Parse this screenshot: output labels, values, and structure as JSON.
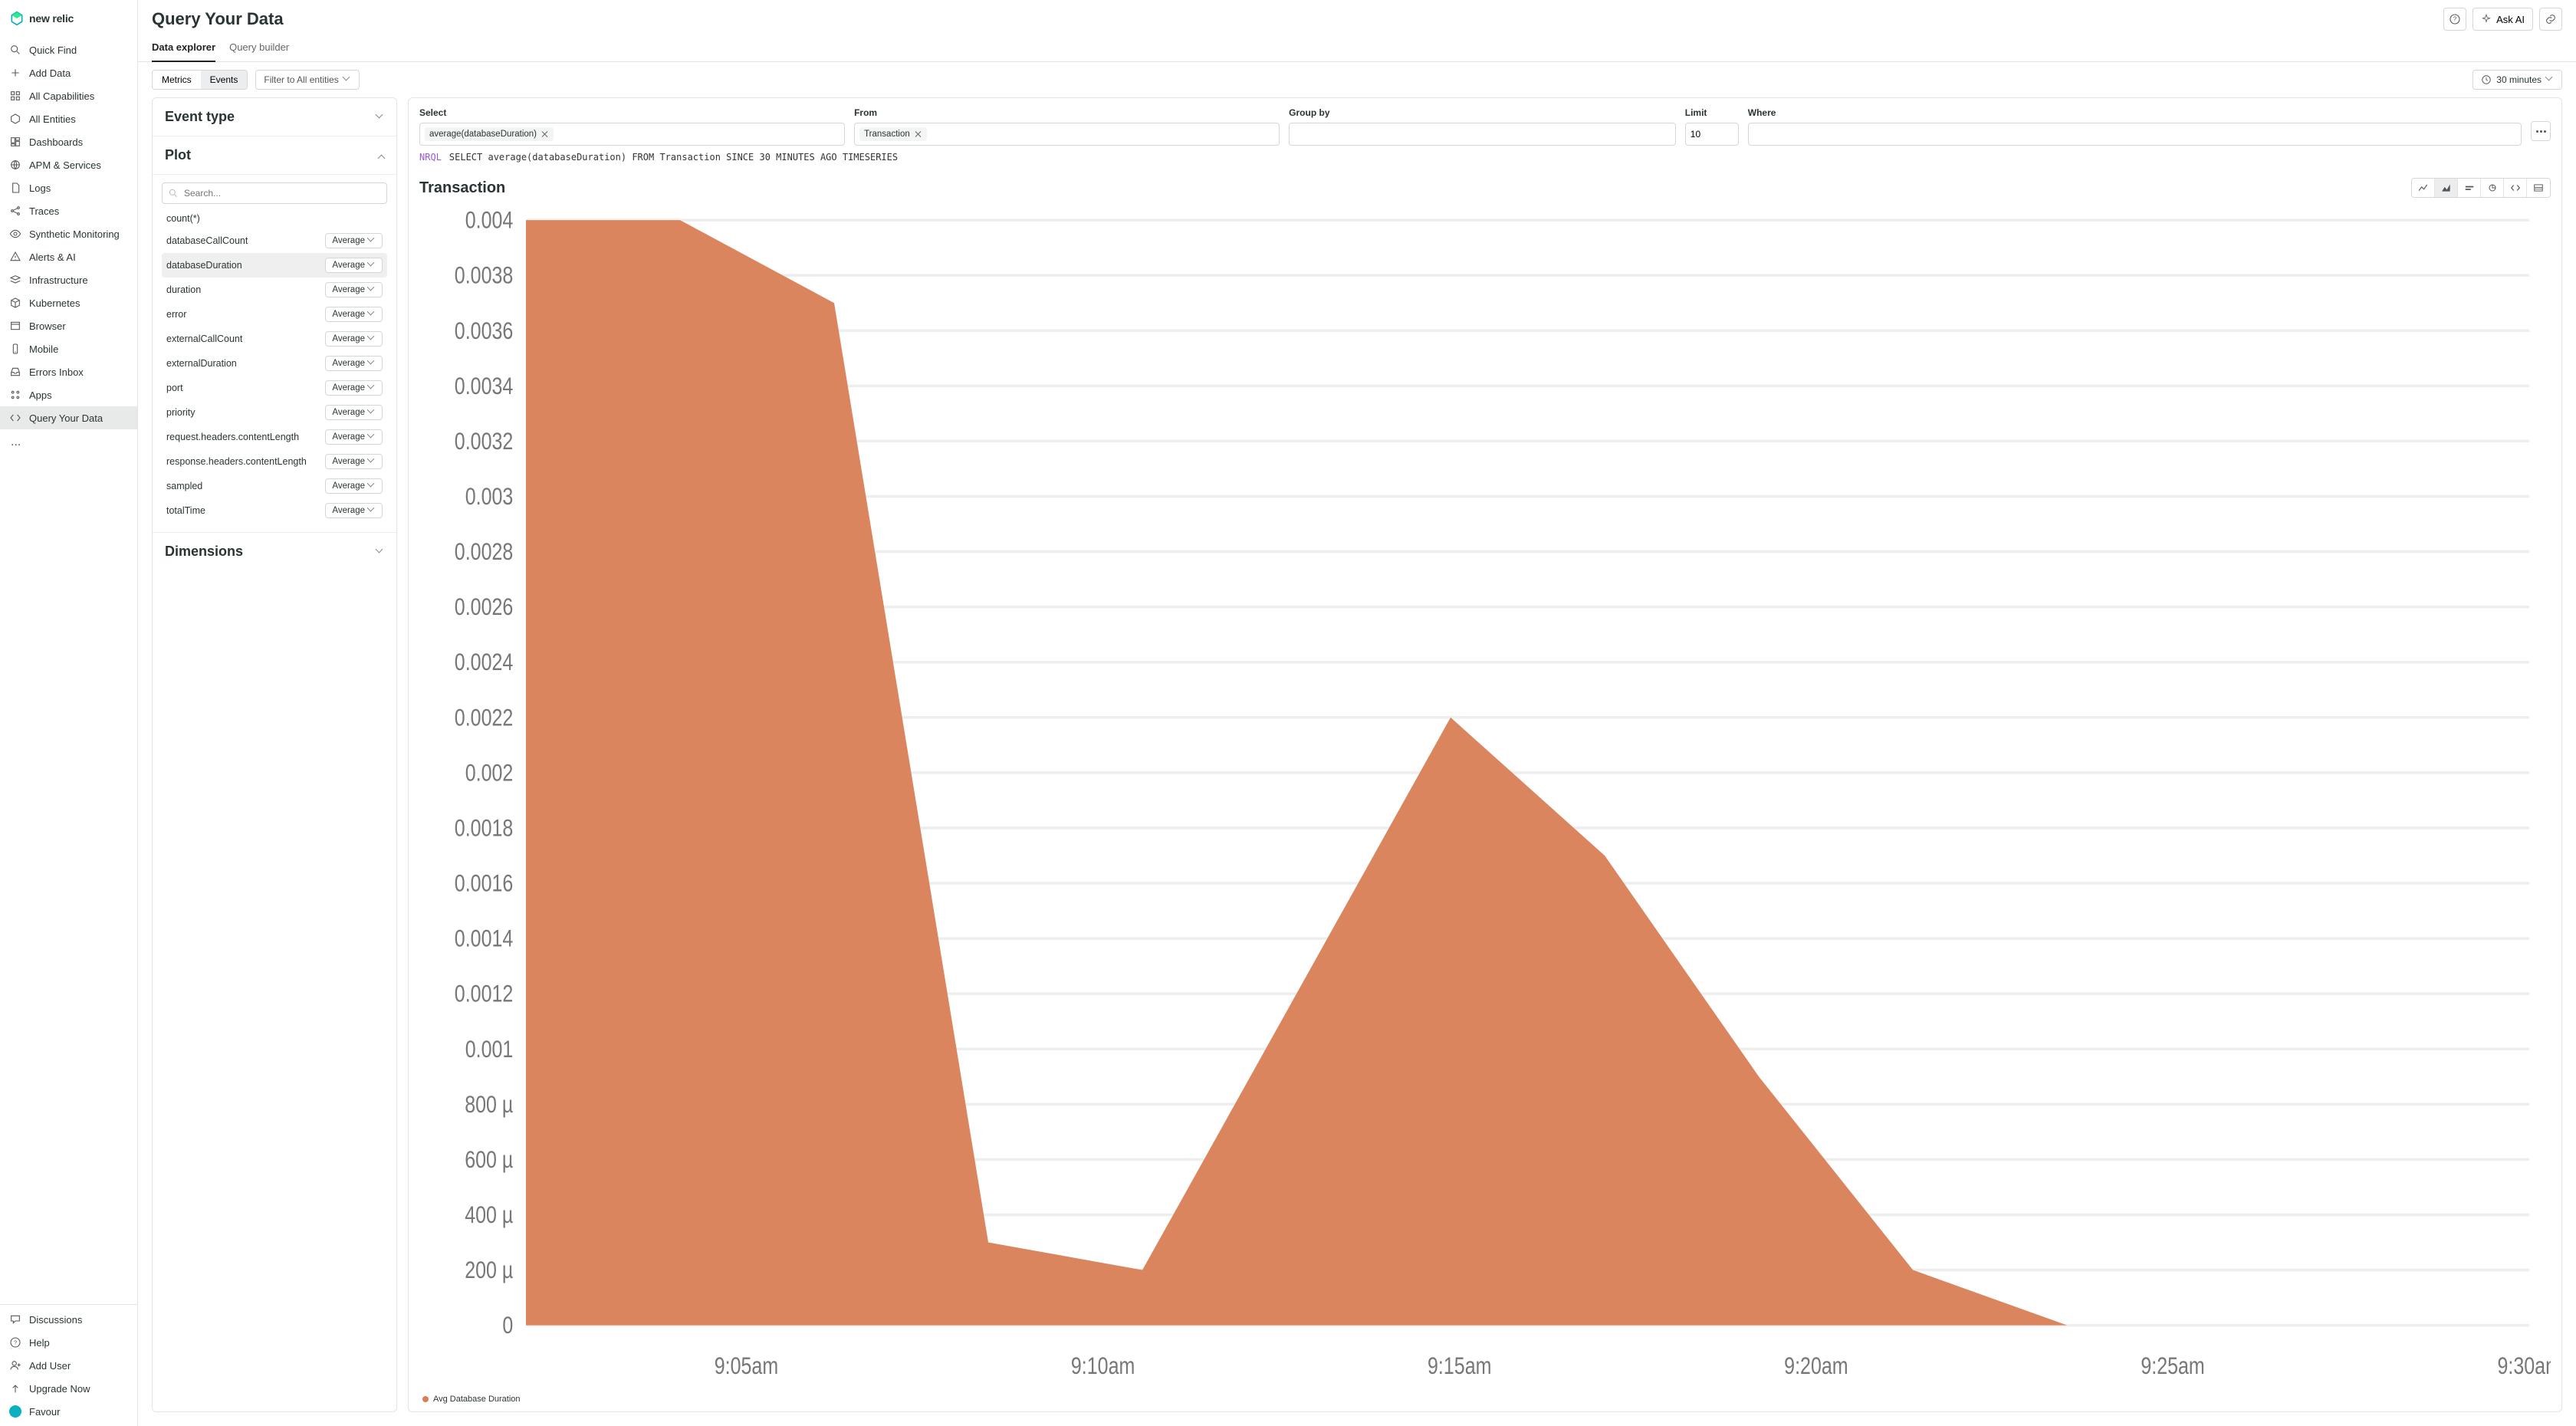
{
  "app": {
    "name": "new relic"
  },
  "sidebar": {
    "items": [
      {
        "id": "quick-find",
        "label": "Quick Find",
        "icon": "search"
      },
      {
        "id": "add-data",
        "label": "Add Data",
        "icon": "plus"
      },
      {
        "id": "all-capabilities",
        "label": "All Capabilities",
        "icon": "grid"
      },
      {
        "id": "all-entities",
        "label": "All Entities",
        "icon": "hexagon"
      },
      {
        "id": "dashboards",
        "label": "Dashboards",
        "icon": "dashboard"
      },
      {
        "id": "apm-services",
        "label": "APM & Services",
        "icon": "globe"
      },
      {
        "id": "logs",
        "label": "Logs",
        "icon": "file"
      },
      {
        "id": "traces",
        "label": "Traces",
        "icon": "share"
      },
      {
        "id": "synthetic-monitoring",
        "label": "Synthetic Monitoring",
        "icon": "eye"
      },
      {
        "id": "alerts-ai",
        "label": "Alerts & AI",
        "icon": "alert"
      },
      {
        "id": "infrastructure",
        "label": "Infrastructure",
        "icon": "stack"
      },
      {
        "id": "kubernetes",
        "label": "Kubernetes",
        "icon": "cube"
      },
      {
        "id": "browser",
        "label": "Browser",
        "icon": "window"
      },
      {
        "id": "mobile",
        "label": "Mobile",
        "icon": "phone"
      },
      {
        "id": "errors-inbox",
        "label": "Errors Inbox",
        "icon": "inbox"
      },
      {
        "id": "apps",
        "label": "Apps",
        "icon": "apps"
      },
      {
        "id": "query-your-data",
        "label": "Query Your Data",
        "icon": "code",
        "active": true
      }
    ],
    "ellipsis": "...",
    "bottom": [
      {
        "id": "discussions",
        "label": "Discussions",
        "icon": "chat"
      },
      {
        "id": "help",
        "label": "Help",
        "icon": "help"
      },
      {
        "id": "add-user",
        "label": "Add User",
        "icon": "user-plus"
      },
      {
        "id": "upgrade-now",
        "label": "Upgrade Now",
        "icon": "up"
      },
      {
        "id": "favour",
        "label": "Favour",
        "icon": "avatar"
      }
    ]
  },
  "header": {
    "title": "Query Your Data",
    "ask_ai": "Ask AI"
  },
  "tabs": [
    {
      "id": "data-explorer",
      "label": "Data explorer",
      "active": true
    },
    {
      "id": "query-builder",
      "label": "Query builder"
    }
  ],
  "toolbar": {
    "metrics": "Metrics",
    "events": "Events",
    "filter": "Filter to All entities",
    "time": "30 minutes"
  },
  "left": {
    "event_type_title": "Event type",
    "plot_title": "Plot",
    "search_placeholder": "Search...",
    "avg_label": "Average",
    "dimensions_title": "Dimensions",
    "plot_items": [
      {
        "name": "count(*)",
        "agg": null
      },
      {
        "name": "databaseCallCount",
        "agg": "Average"
      },
      {
        "name": "databaseDuration",
        "agg": "Average",
        "selected": true
      },
      {
        "name": "duration",
        "agg": "Average"
      },
      {
        "name": "error",
        "agg": "Average"
      },
      {
        "name": "externalCallCount",
        "agg": "Average"
      },
      {
        "name": "externalDuration",
        "agg": "Average"
      },
      {
        "name": "port",
        "agg": "Average"
      },
      {
        "name": "priority",
        "agg": "Average"
      },
      {
        "name": "request.headers.contentLength",
        "agg": "Average"
      },
      {
        "name": "response.headers.contentLength",
        "agg": "Average"
      },
      {
        "name": "sampled",
        "agg": "Average"
      },
      {
        "name": "totalTime",
        "agg": "Average"
      }
    ]
  },
  "query": {
    "select_label": "Select",
    "from_label": "From",
    "group_label": "Group by",
    "limit_label": "Limit",
    "where_label": "Where",
    "select_tag": "average(databaseDuration)",
    "from_tag": "Transaction",
    "limit_value": "10",
    "nrql_label": "NRQL",
    "nrql_text": "SELECT average(databaseDuration) FROM Transaction SINCE 30 MINUTES AGO TIMESERIES"
  },
  "chart": {
    "title": "Transaction",
    "legend": "Avg Database Duration",
    "color": "#d97e56"
  },
  "chart_data": {
    "type": "area",
    "title": "Transaction",
    "xlabel": "",
    "ylabel": "",
    "ylim": [
      0,
      0.004
    ],
    "y_ticks": [
      "0.004",
      "0.0038",
      "0.0036",
      "0.0034",
      "0.0032",
      "0.003",
      "0.0028",
      "0.0026",
      "0.0024",
      "0.0022",
      "0.002",
      "0.0018",
      "0.0016",
      "0.0014",
      "0.0012",
      "0.001",
      "800 µ",
      "600 µ",
      "400 µ",
      "200 µ",
      "0"
    ],
    "x_ticks": [
      "9:05am",
      "9:10am",
      "9:15am",
      "9:20am",
      "9:25am",
      "9:30am"
    ],
    "series": [
      {
        "name": "Avg Database Duration",
        "color": "#d97e56",
        "x": [
          "9:02",
          "9:03",
          "9:04",
          "9:05",
          "9:06",
          "9:07",
          "9:08",
          "9:09",
          "9:10",
          "9:11",
          "9:12",
          "9:13",
          "9:14",
          "9:30"
        ],
        "values": [
          0.004,
          0.004,
          0.0037,
          0.0003,
          0.0002,
          0.0012,
          0.0022,
          0.0017,
          0.0009,
          0.0002,
          0,
          0,
          0,
          0
        ]
      }
    ]
  }
}
